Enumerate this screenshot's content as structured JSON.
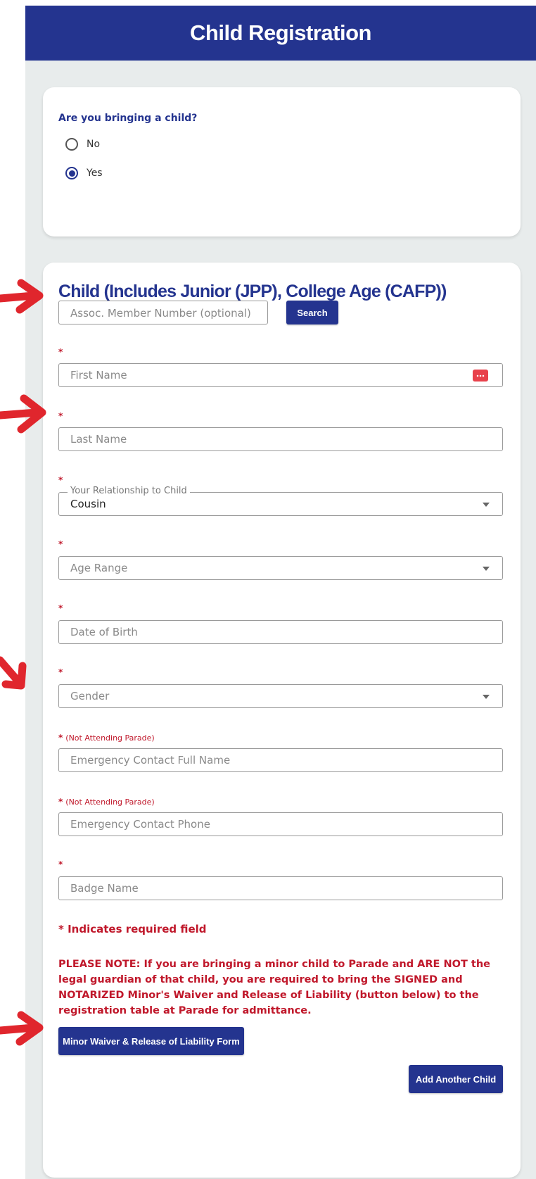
{
  "header": {
    "title": "Child Registration"
  },
  "bringing_child": {
    "question": "Are you bringing a child?",
    "options": [
      {
        "label": "No",
        "selected": false
      },
      {
        "label": "Yes",
        "selected": true
      }
    ]
  },
  "child_section": {
    "title": "Child (Includes Junior (JPP), College Age (CAFP))",
    "assoc_placeholder": "Assoc. Member Number (optional)",
    "search_label": "Search",
    "required_mark": "*",
    "not_attending_note": "(Not Attending Parade)",
    "fields": {
      "first_name": "First Name",
      "last_name": "Last Name",
      "relationship_label": "Your Relationship to Child",
      "relationship_value": "Cousin",
      "age_range": "Age Range",
      "dob": "Date of Birth",
      "gender": "Gender",
      "emergency_name": "Emergency Contact Full Name",
      "emergency_phone": "Emergency Contact Phone",
      "badge_name": "Badge Name"
    },
    "required_note": "* Indicates required field",
    "please_note": "PLEASE NOTE: If you are bringing a minor child to Parade and ARE NOT the legal guardian of that child, you are required to bring the SIGNED and NOTARIZED Minor's Waiver and Release of Liability (button below) to the registration table at Parade for admittance.",
    "waiver_button": "Minor Waiver & Release of Liability Form",
    "add_button": "Add Another Child"
  },
  "colors": {
    "brand": "#24348f",
    "required": "#c0182b",
    "annotation_arrow": "#e0262d"
  }
}
